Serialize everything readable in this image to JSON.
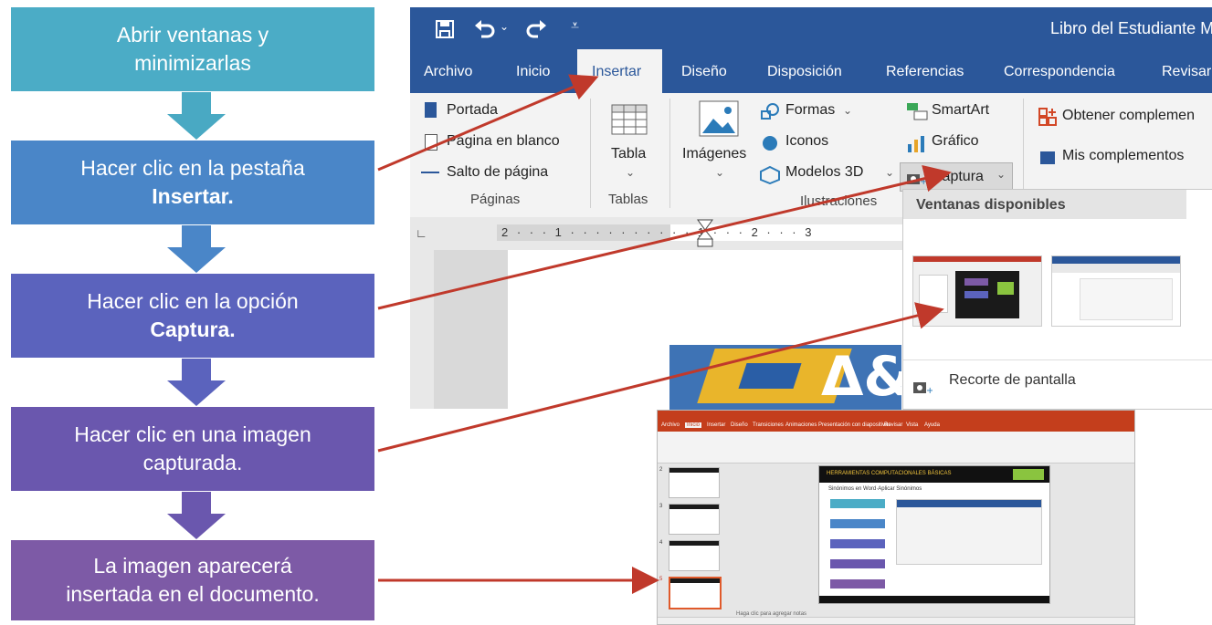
{
  "steps": [
    {
      "line1": "Abrir ventanas y",
      "line2": "minimizarlas",
      "bold": "",
      "color": "#4bacc6"
    },
    {
      "line1": "Hacer clic en la pestaña",
      "line2": "",
      "bold": "Insertar.",
      "color": "#4a86c8"
    },
    {
      "line1": "Hacer clic en la opción",
      "line2": "",
      "bold": "Captura.",
      "color": "#5b63bd"
    },
    {
      "line1": "Hacer clic en una imagen",
      "line2": "capturada.",
      "bold": "",
      "color": "#6a57ae"
    },
    {
      "line1": "La imagen aparecerá",
      "line2": "insertada en el documento.",
      "bold": "",
      "color": "#7d5aa6"
    }
  ],
  "word": {
    "title": "Libro del Estudiante M",
    "tabs": [
      "Archivo",
      "Inicio",
      "Insertar",
      "Diseño",
      "Disposición",
      "Referencias",
      "Correspondencia",
      "Revisar"
    ],
    "active_tab": "Insertar",
    "paginas": {
      "items": [
        "Portada",
        "Página en blanco",
        "Salto de página"
      ],
      "group": "Páginas"
    },
    "tablas": {
      "item": "Tabla",
      "group": "Tablas"
    },
    "ilustraciones": {
      "imagenes": "Imágenes",
      "formas": "Formas",
      "iconos": "Iconos",
      "modelos": "Modelos 3D",
      "smartart": "SmartArt",
      "grafico": "Gráfico",
      "captura": "Captura",
      "group": "Ilustraciones"
    },
    "complementos": {
      "obtener": "Obtener complemen",
      "mis": "Mis complementos"
    },
    "ruler_text": "2 · · · 1 · · · · · · · · · · 1 · · · 2 · · · 3",
    "dropdown": {
      "header": "Ventanas disponibles",
      "recorte": "Recorte de pantalla"
    }
  },
  "ppt": {
    "tabs": [
      "Archivo",
      "Inicio",
      "Insertar",
      "Diseño",
      "Transiciones",
      "Animaciones",
      "Presentación con diapositivas",
      "Revisar",
      "Vista",
      "Ayuda"
    ],
    "slide_banner": "HERRAMIENTAS COMPUTACIONALES BÁSICAS",
    "slide_subtitle": "Sinónimos en Word·Aplicar Sinónimos",
    "notes": "Haga clic para agregar notas",
    "slide_numbers": [
      "2",
      "3",
      "4",
      "5"
    ]
  },
  "colors": {
    "word_blue": "#2b579a",
    "arrow_red": "#c0392b",
    "chevron_teal": "#49a9c3",
    "chevron_blue": "#4a86c8",
    "chevron_indigo": "#5b63bd",
    "chevron_purple": "#6a57ae"
  }
}
